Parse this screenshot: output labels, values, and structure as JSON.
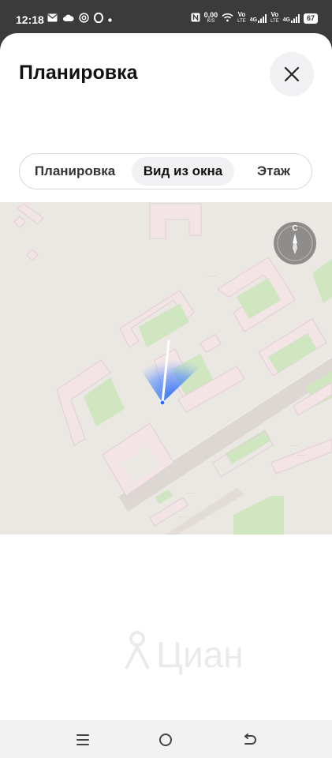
{
  "status_bar": {
    "time": "12:18",
    "net_speed_value": "0,00",
    "net_speed_unit": "K/S",
    "carrier1_top": "Vo",
    "carrier1_bottom": "LTE",
    "signal1_label": "4G",
    "carrier2_top": "Vo",
    "carrier2_bottom": "LTE",
    "signal2_label": "4G",
    "battery": "67"
  },
  "header": {
    "title": "Планировка"
  },
  "tabs": [
    {
      "label": "Планировка",
      "active": false
    },
    {
      "label": "Вид из окна",
      "active": true
    },
    {
      "label": "Этаж",
      "active": false
    }
  ],
  "map": {
    "compass_letter": "С"
  },
  "watermark": {
    "text": "Циан"
  },
  "colors": {
    "accent_view_cone": "#2f6df6",
    "map_background": "#ebe7e3",
    "building_fill": "#f3e4e6",
    "green_area": "#cfe6c0"
  }
}
